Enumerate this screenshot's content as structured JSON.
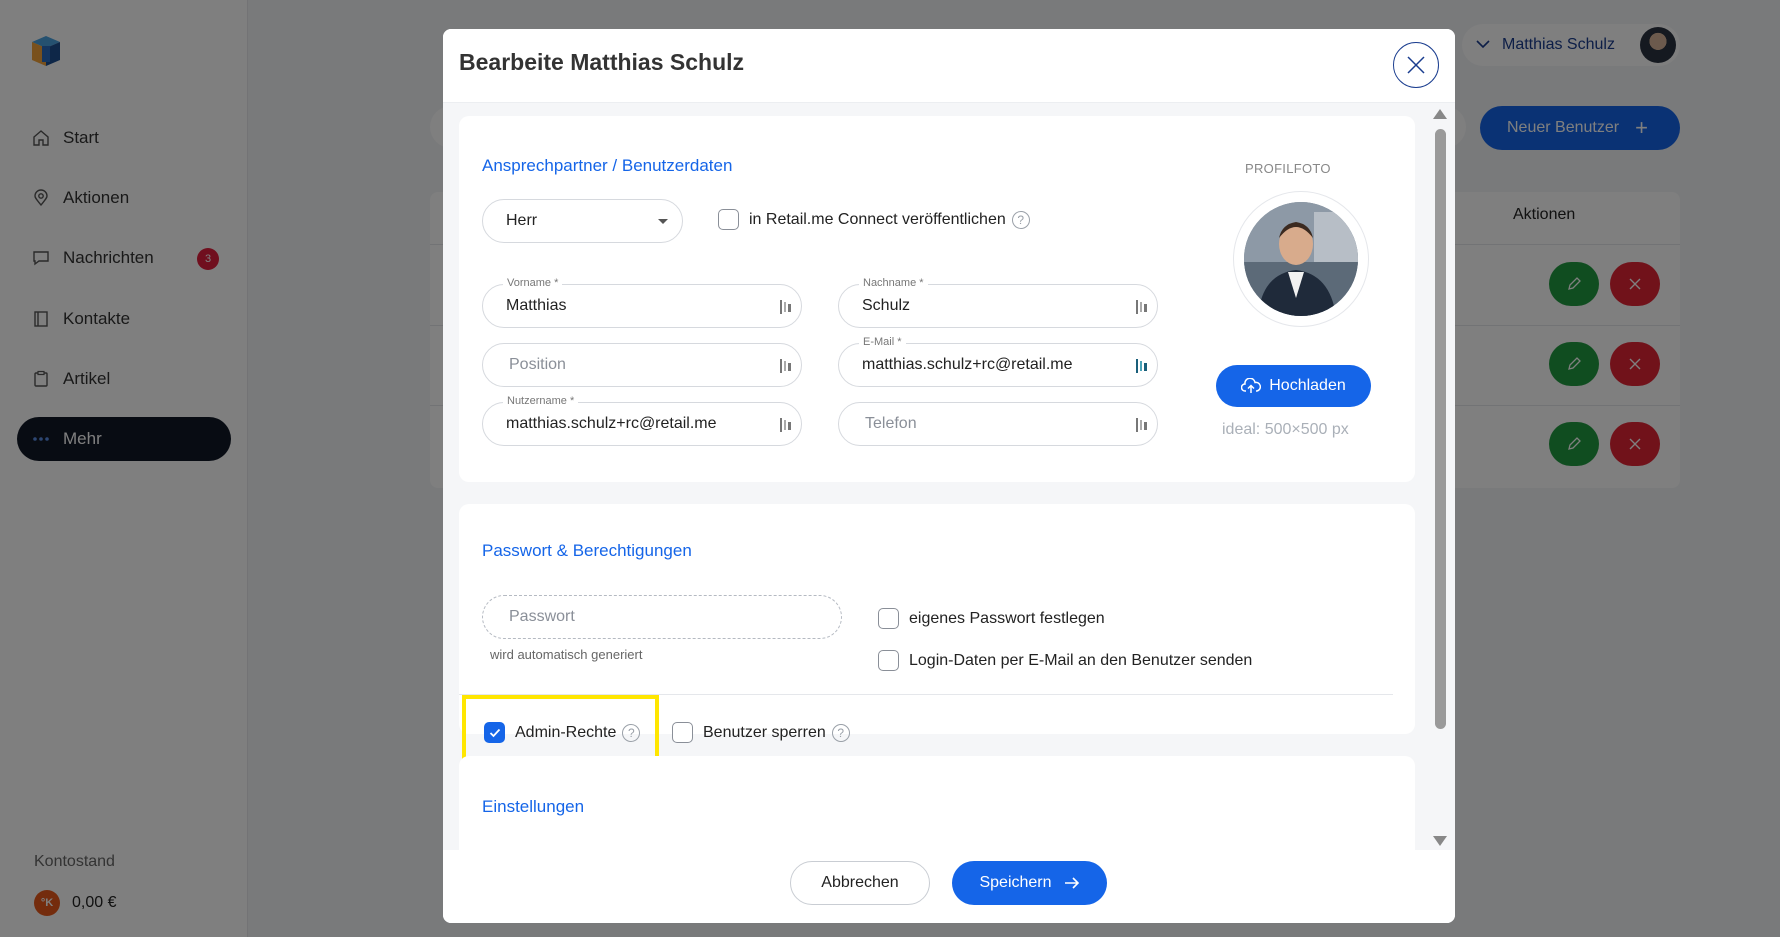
{
  "sidebar": {
    "items": [
      {
        "label": "Start",
        "icon": "home-icon"
      },
      {
        "label": "Aktionen",
        "icon": "location-pin-icon"
      },
      {
        "label": "Nachrichten",
        "icon": "chat-icon",
        "badge": "3"
      },
      {
        "label": "Kontakte",
        "icon": "address-book-icon"
      },
      {
        "label": "Artikel",
        "icon": "clipboard-icon"
      },
      {
        "label": "Mehr",
        "icon": "more-dots-icon",
        "active": true
      }
    ],
    "balance_label": "Kontostand",
    "balance_coin": "°K",
    "balance_value": "0,00 €"
  },
  "topbar": {
    "user_name": "Matthias Schulz",
    "new_user_label": "Neuer Benutzer",
    "new_user_icon": "+"
  },
  "table": {
    "actions_header": "Aktionen"
  },
  "modal": {
    "title": "Bearbeite Matthias Schulz",
    "contact": {
      "title": "Ansprechpartner / Benutzerdaten",
      "salutation": "Herr",
      "publish_label": "in Retail.me Connect veröffentlichen",
      "firstname_label": "Vorname *",
      "firstname_value": "Matthias",
      "lastname_label": "Nachname *",
      "lastname_value": "Schulz",
      "position_placeholder": "Position",
      "email_label": "E-Mail *",
      "email_value": "matthias.schulz+rc@retail.me",
      "username_label": "Nutzername *",
      "username_value": "matthias.schulz+rc@retail.me",
      "phone_placeholder": "Telefon",
      "profile_label": "PROFILFOTO",
      "upload_label": "Hochladen",
      "ideal_hint": "ideal: 500×500 px"
    },
    "password": {
      "title": "Passwort & Berechtigungen",
      "password_placeholder": "Passwort",
      "hint": "wird automatisch generiert",
      "own_password_label": "eigenes Passwort festlegen",
      "send_login_label": "Login-Daten per E-Mail an den Benutzer senden",
      "admin_label": "Admin-Rechte",
      "admin_checked": true,
      "lock_label": "Benutzer sperren",
      "lock_checked": false
    },
    "settings": {
      "title": "Einstellungen"
    },
    "footer": {
      "cancel_label": "Abbrechen",
      "save_label": "Speichern"
    },
    "help_glyph": "?"
  },
  "colors": {
    "accent": "#1565e8",
    "sidebar_active": "#111827",
    "highlight": "#ffe600",
    "edit": "#219a41",
    "delete": "#e32435"
  }
}
